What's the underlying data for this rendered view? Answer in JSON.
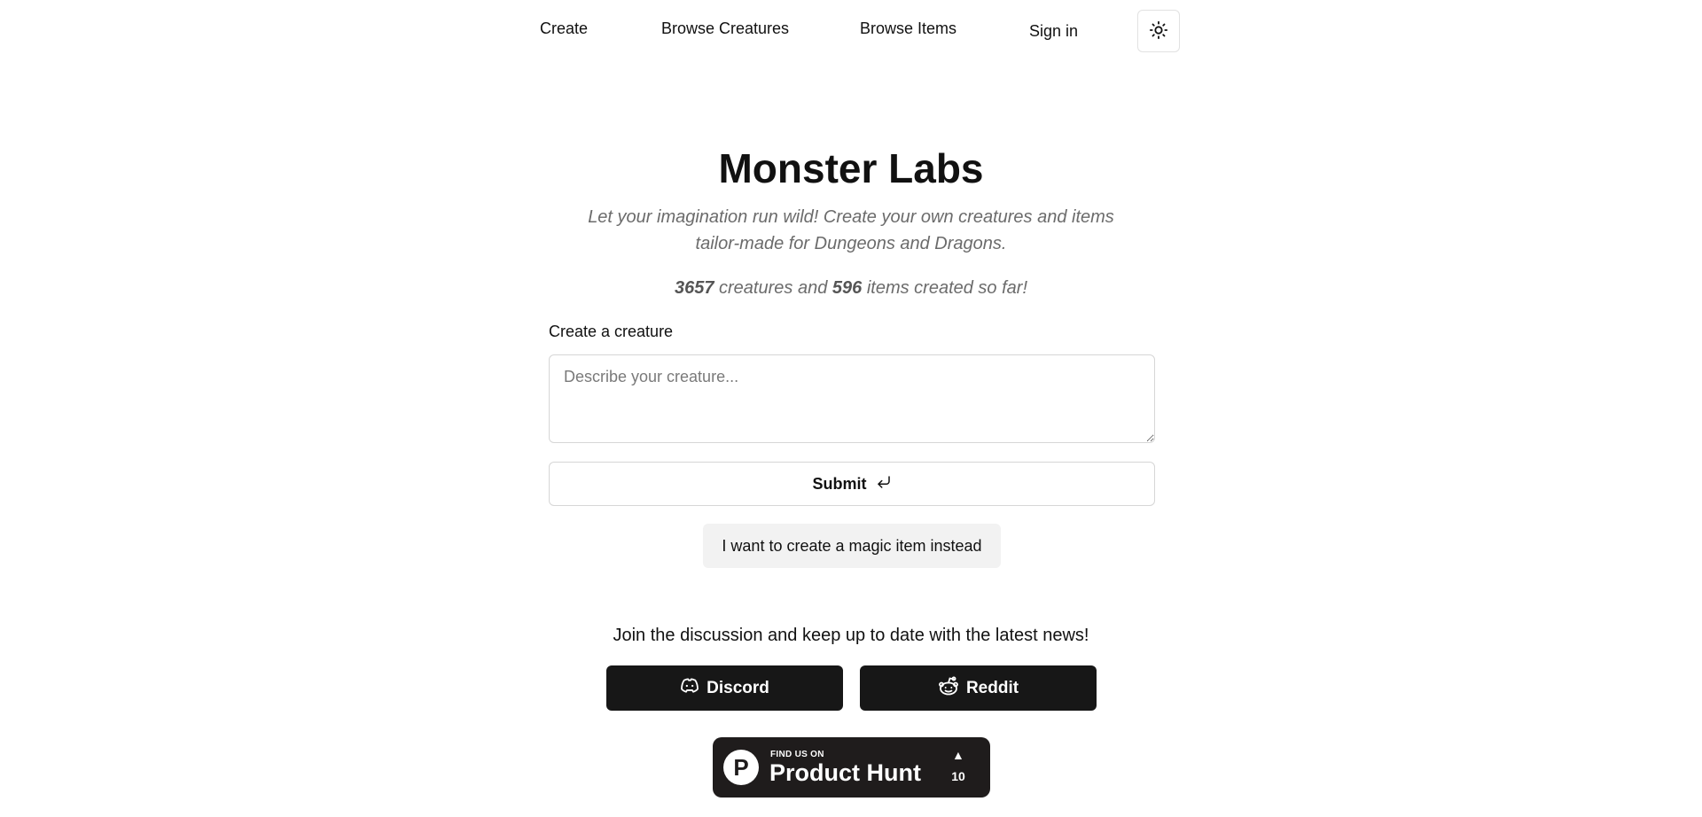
{
  "nav": {
    "create": "Create",
    "browse_creatures": "Browse Creatures",
    "browse_items": "Browse Items",
    "sign_in": "Sign in",
    "theme_icon": "sun-icon"
  },
  "hero": {
    "title": "Monster Labs",
    "tagline": "Let your imagination run wild! Create your own creatures and items tailor-made for Dungeons and Dragons.",
    "stats": {
      "creatures_count": "3657",
      "creatures_text": " creatures and ",
      "items_count": "596",
      "items_text": " items created so far!"
    }
  },
  "form": {
    "label": "Create a creature",
    "placeholder": "Describe your creature...",
    "value": "",
    "submit_label": "Submit",
    "submit_icon": "enter-arrow-icon",
    "alt_button_label": "I want to create a magic item instead"
  },
  "community": {
    "heading": "Join the discussion and keep up to date with the latest news!",
    "discord_label": "Discord",
    "discord_icon": "discord-icon",
    "reddit_label": "Reddit",
    "reddit_icon": "reddit-icon"
  },
  "product_hunt": {
    "logo_letter": "P",
    "small_text": "FIND US ON",
    "big_text": "Product Hunt",
    "upvote_icon": "▲",
    "upvotes": "10"
  },
  "colors": {
    "background": "#ffffff",
    "text": "#111111",
    "muted_text": "#6b6b6b",
    "social_button_bg": "#171717",
    "product_hunt_bg": "#1f1c1c",
    "secondary_button_bg": "#f2f2f2"
  }
}
